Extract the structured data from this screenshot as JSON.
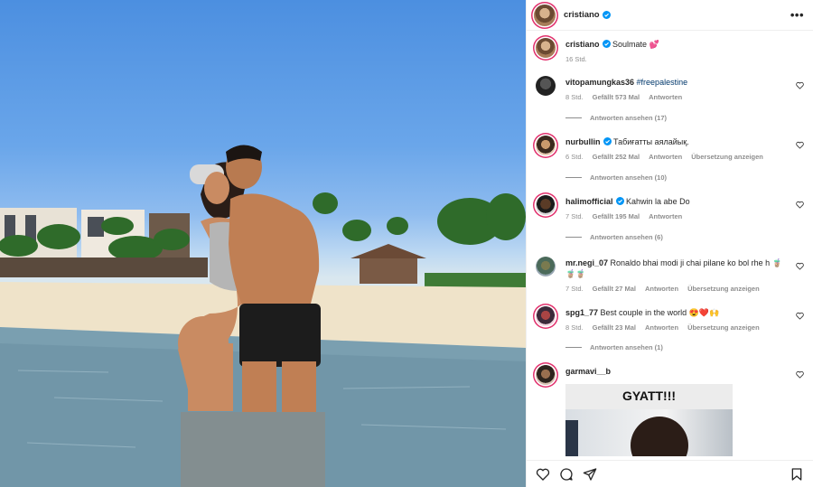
{
  "post": {
    "author": "cristiano",
    "caption": "Soulmate 💕",
    "time": "16 Std."
  },
  "comments": [
    {
      "user": "vitopamungkas36",
      "tag": "#freepalestine",
      "time": "8 Std.",
      "likes": "Gefällt 573 Mal",
      "reply": "Antworten",
      "view_replies": "Antworten ansehen (17)"
    },
    {
      "user": "nurbullin",
      "text": "Табиғатты аялайық.",
      "time": "6 Std.",
      "likes": "Gefällt 252 Mal",
      "reply": "Antworten",
      "translate": "Übersetzung anzeigen",
      "view_replies": "Antworten ansehen (10)"
    },
    {
      "user": "halimofficial",
      "text": "Kahwin la abe Do",
      "time": "7 Std.",
      "likes": "Gefällt 195 Mal",
      "reply": "Antworten",
      "view_replies": "Antworten ansehen (6)"
    },
    {
      "user": "mr.negi_07",
      "text": "Ronaldo bhai modi ji chai pilane ko bol rhe h 🧋🧋🧋",
      "time": "7 Std.",
      "likes": "Gefällt 27 Mal",
      "reply": "Antworten",
      "translate": "Übersetzung anzeigen"
    },
    {
      "user": "spg1_77",
      "text": "Best couple in the world 😍❤️🙌",
      "time": "8 Std.",
      "likes": "Gefällt 23 Mal",
      "reply": "Antworten",
      "translate": "Übersetzung anzeigen",
      "view_replies": "Antworten ansehen (1)"
    },
    {
      "user": "garmavi__b",
      "gif_text": "GYATT!!!"
    }
  ],
  "icons": {
    "more": "more-options-icon",
    "verified": "verified-badge-icon",
    "like": "heart-icon",
    "comment": "comment-icon",
    "share": "share-icon",
    "save": "bookmark-icon"
  },
  "colors": {
    "accent": "#0095f6",
    "link": "#00376b",
    "muted": "#8e8e8e"
  }
}
